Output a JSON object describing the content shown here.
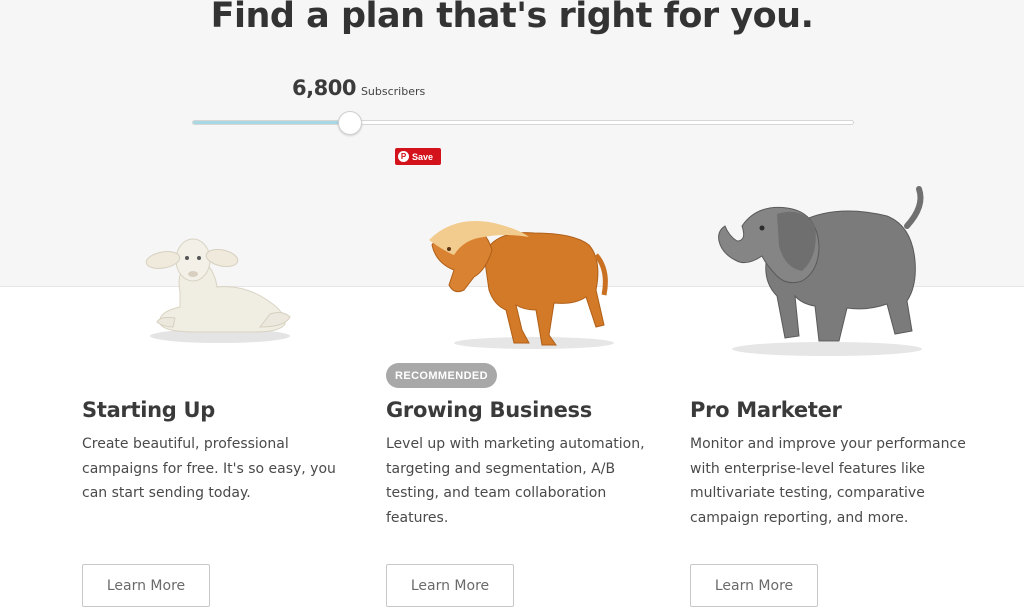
{
  "header": {
    "title": "Find a plan that's right for you."
  },
  "slider": {
    "value": "6,800",
    "unit_label": "Subscribers",
    "fill_fraction": 0.24
  },
  "pinterest": {
    "save_label": "Save",
    "icon_glyph": "P"
  },
  "colors": {
    "accent_fill": "#a8d8e3",
    "pinterest_red": "#d3121c",
    "badge_gray": "#a8a8a8"
  },
  "plans": [
    {
      "figure": "lamb-figurine",
      "title": "Starting Up",
      "description": "Create beautiful, professional campaigns for free. It's so easy, you can start sending today.",
      "button_label": "Learn More"
    },
    {
      "figure": "horse-figurine",
      "badge": "RECOMMENDED",
      "title": "Growing Business",
      "description": "Level up with marketing automation, targeting and segmentation, A/B testing, and team collaboration features.",
      "button_label": "Learn More"
    },
    {
      "figure": "elephant-figurine",
      "title": "Pro Marketer",
      "description": "Monitor and improve your performance with enterprise-level features like multivariate testing, comparative campaign reporting, and more.",
      "button_label": "Learn More"
    }
  ]
}
